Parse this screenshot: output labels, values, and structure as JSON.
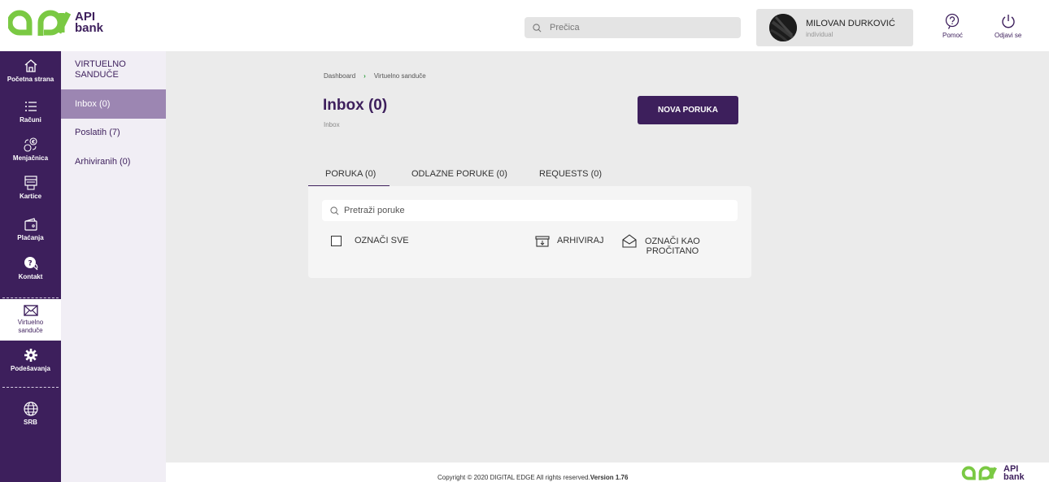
{
  "brand": {
    "line1": "API",
    "line2": "bank",
    "green": "#7ac943",
    "purple": "#3d1f5c"
  },
  "header": {
    "search_placeholder": "Prečica",
    "user_name": "MILOVAN DURKOVIĆ",
    "user_type": "individual",
    "help_label": "Pomoć",
    "logout_label": "Odjavi se"
  },
  "nav": {
    "home": "Početna strana",
    "accounts": "Računi",
    "exchange": "Menjačnica",
    "cards": "Kartice",
    "payments": "Plaćanja",
    "contact": "Kontakt",
    "mailbox": "Virtuelno sanduče",
    "settings": "Podešavanja",
    "language": "SRB"
  },
  "subnav": {
    "title": "VIRTUELNO SANDUČE",
    "items": [
      {
        "label": "Inbox (0)",
        "active": true
      },
      {
        "label": "Poslatih (7)",
        "active": false
      },
      {
        "label": "Arhiviranih (0)",
        "active": false
      }
    ]
  },
  "main": {
    "breadcrumb": [
      "Dashboard",
      "Virtuelno sanduče"
    ],
    "breadcrumb_sep": "›",
    "title": "Inbox (0)",
    "subtitle": "Inbox",
    "new_message": "NOVA PORUKA",
    "tabs": [
      "PORUKA (0)",
      "ODLAZNE PORUKE (0)",
      "REQUESTS (0)"
    ],
    "search_placeholder": "Pretraži poruke",
    "select_all": "OZNAČI SVE",
    "archive": "ARHIVIRAJ",
    "mark_read_line1": "OZNAČI KAO",
    "mark_read_line2": "PROČITANO"
  },
  "footer": {
    "copyright": "Copyright © 2020 DIGITAL EDGE All rights reserved.",
    "version": "Version 1.76"
  }
}
